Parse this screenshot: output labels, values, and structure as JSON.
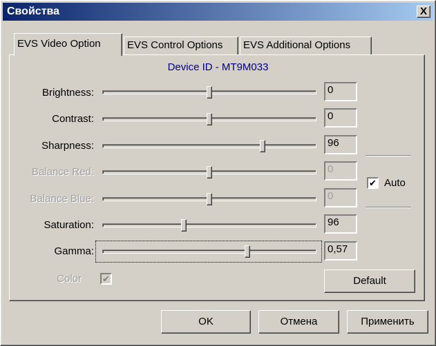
{
  "window": {
    "title": "Свойства",
    "close_label": "X"
  },
  "tabs": [
    {
      "label": "EVS Video Option"
    },
    {
      "label": "EVS Control Options"
    },
    {
      "label": "EVS Additional Options"
    }
  ],
  "device_id": "Device ID - MT9M033",
  "sliders": [
    {
      "label": "Brightness:",
      "value": "0",
      "level": 0.5,
      "enabled": true
    },
    {
      "label": "Contrast:",
      "value": "0",
      "level": 0.5,
      "enabled": true
    },
    {
      "label": "Sharpness:",
      "value": "96",
      "level": 0.75,
      "enabled": true
    },
    {
      "label": "Balance Red:",
      "value": "0",
      "level": 0.5,
      "enabled": false
    },
    {
      "label": "Balance Blue:",
      "value": "0",
      "level": 0.5,
      "enabled": false
    },
    {
      "label": "Saturation:",
      "value": "96",
      "level": 0.38,
      "enabled": true
    },
    {
      "label": "Gamma:",
      "value": "0,57",
      "level": 0.68,
      "enabled": true
    }
  ],
  "auto": {
    "label": "Auto",
    "checked": true
  },
  "color": {
    "label": "Color",
    "checked": true,
    "enabled": false
  },
  "buttons": {
    "default": "Default",
    "ok": "OK",
    "cancel": "Отмена",
    "apply": "Применить"
  }
}
